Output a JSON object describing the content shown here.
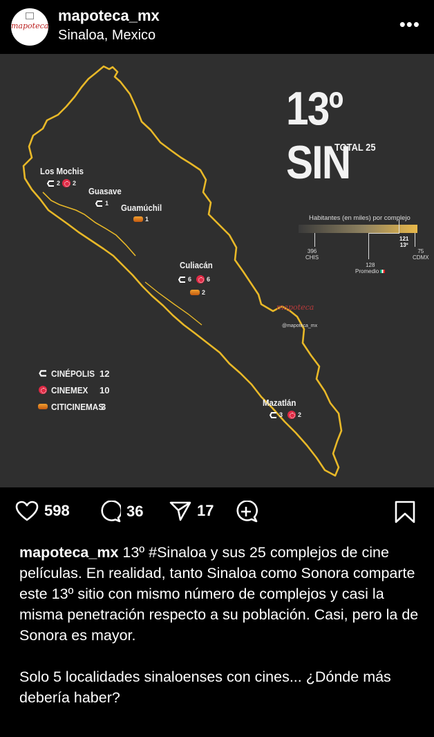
{
  "header": {
    "username": "mapoteca_mx",
    "location": "Sinaloa, Mexico",
    "avatar_text": "mapoteca",
    "more_icon": "more-dots-icon"
  },
  "post": {
    "title": "13º SIN",
    "total": "TOTAL  25",
    "cities": [
      {
        "name": "Los Mochis",
        "brands": [
          {
            "brand": "cinepolis",
            "count": "2"
          },
          {
            "brand": "cinemex",
            "count": "2"
          }
        ]
      },
      {
        "name": "Guasave",
        "brands": [
          {
            "brand": "cinepolis",
            "count": "1"
          }
        ]
      },
      {
        "name": "Guamúchil",
        "brands": [
          {
            "brand": "citicinemas",
            "count": "1"
          }
        ]
      },
      {
        "name": "Culiacán",
        "brands": [
          {
            "brand": "cinepolis",
            "count": "6"
          },
          {
            "brand": "cinemex",
            "count": "6"
          },
          {
            "brand": "citicinemas",
            "count": "2"
          }
        ]
      },
      {
        "name": "Mazatlán",
        "brands": [
          {
            "brand": "cinepolis",
            "count": "3"
          },
          {
            "brand": "cinemex",
            "count": "2"
          }
        ]
      }
    ],
    "legend": [
      {
        "name": "CINÉPOLIS",
        "count": "12",
        "icon": "cinepolis-icon"
      },
      {
        "name": "CINEMEX",
        "count": "10",
        "icon": "cinemex-icon"
      },
      {
        "name": "CITICINEMAS",
        "count": "3",
        "icon": "citicinemas-icon"
      }
    ],
    "habitantes": {
      "title": "Habitantes (en miles) por complejo",
      "chis_value": "396",
      "chis_label": "CHIS",
      "promedio_value": "128",
      "promedio_label": "Promedio",
      "sin_value": "121",
      "sin_label": "13º",
      "cdmx_value": "75",
      "cdmx_label": "CDMX"
    },
    "watermark": "mapoteca",
    "watermark_handle": "@mapoteca_mx",
    "colors": {
      "background": "#2f2f2f",
      "outline": "#e8b828",
      "cinemex": "#e02a45",
      "citicinemas": "#e07a20"
    }
  },
  "actions": {
    "likes": "598",
    "comments": "36",
    "shares": "17"
  },
  "caption": {
    "username": "mapoteca_mx",
    "text1": " 13º #Sinaloa y sus 25 complejos de cine películas. En realidad, tanto Sinaloa como Sonora comparte este 13º sitio con mismo número de complejos y casi la misma penetración respecto a su población. Casi, pero la de Sonora es mayor.",
    "text2": "Solo 5 localidades sinaloenses con cines... ¿Dónde más debería haber?"
  }
}
